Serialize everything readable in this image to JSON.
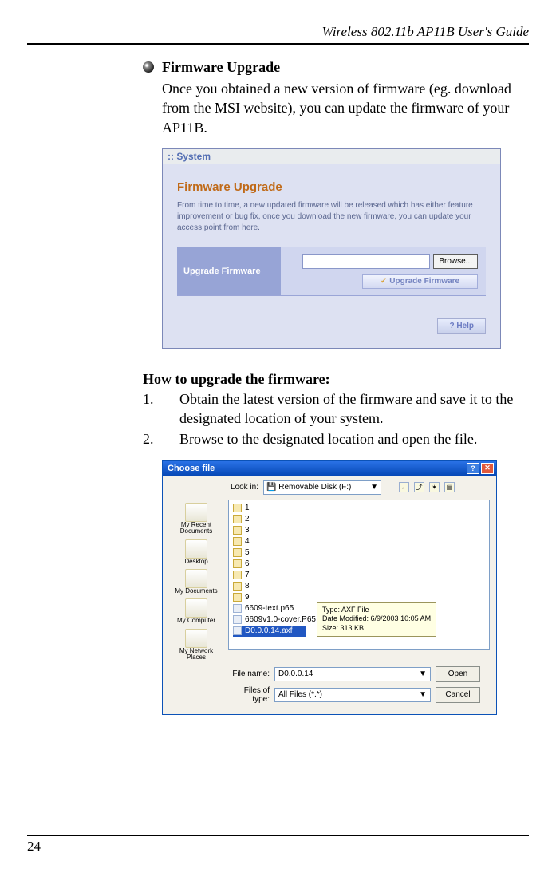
{
  "header": {
    "title": "Wireless 802.11b AP11B User's Guide"
  },
  "section": {
    "bullet_title": "Firmware Upgrade",
    "intro": "Once you obtained a new version of firmware (eg. download from the MSI website), you can update the firmware of your AP11B."
  },
  "ui1": {
    "breadcrumb": "System",
    "heading": "Firmware Upgrade",
    "desc": "From time to time, a new updated firmware will be released which has either feature improvement or bug fix, once you download the new firmware, you can update your access point from here.",
    "left_label": "Upgrade Firmware",
    "browse_btn": "Browse...",
    "upgrade_btn": "Upgrade Firmware",
    "help_btn": "? Help"
  },
  "howto": {
    "title": "How to upgrade the firmware:",
    "steps": [
      "Obtain the latest version of the firmware and save it to the designated location of your system.",
      "Browse to the designated location and open the file."
    ]
  },
  "ui2": {
    "title": "Choose file",
    "lookin_label": "Look in:",
    "lookin_value": "Removable Disk (F:)",
    "sidebar": [
      "My Recent Documents",
      "Desktop",
      "My Documents",
      "My Computer",
      "My Network Places"
    ],
    "files": [
      "1",
      "2",
      "3",
      "4",
      "5",
      "6",
      "7",
      "8",
      "9",
      "6609-text.p65",
      "6609v1.0-cover.P65",
      "D0.0.0.14.axf"
    ],
    "tooltip": {
      "type": "Type: AXF File",
      "date": "Date Modified: 6/9/2003 10:05 AM",
      "size": "Size: 313 KB"
    },
    "filename_label": "File name:",
    "filename_value": "D0.0.0.14",
    "filetype_label": "Files of type:",
    "filetype_value": "All Files (*.*)",
    "open_btn": "Open",
    "cancel_btn": "Cancel"
  },
  "footer": {
    "page": "24"
  }
}
